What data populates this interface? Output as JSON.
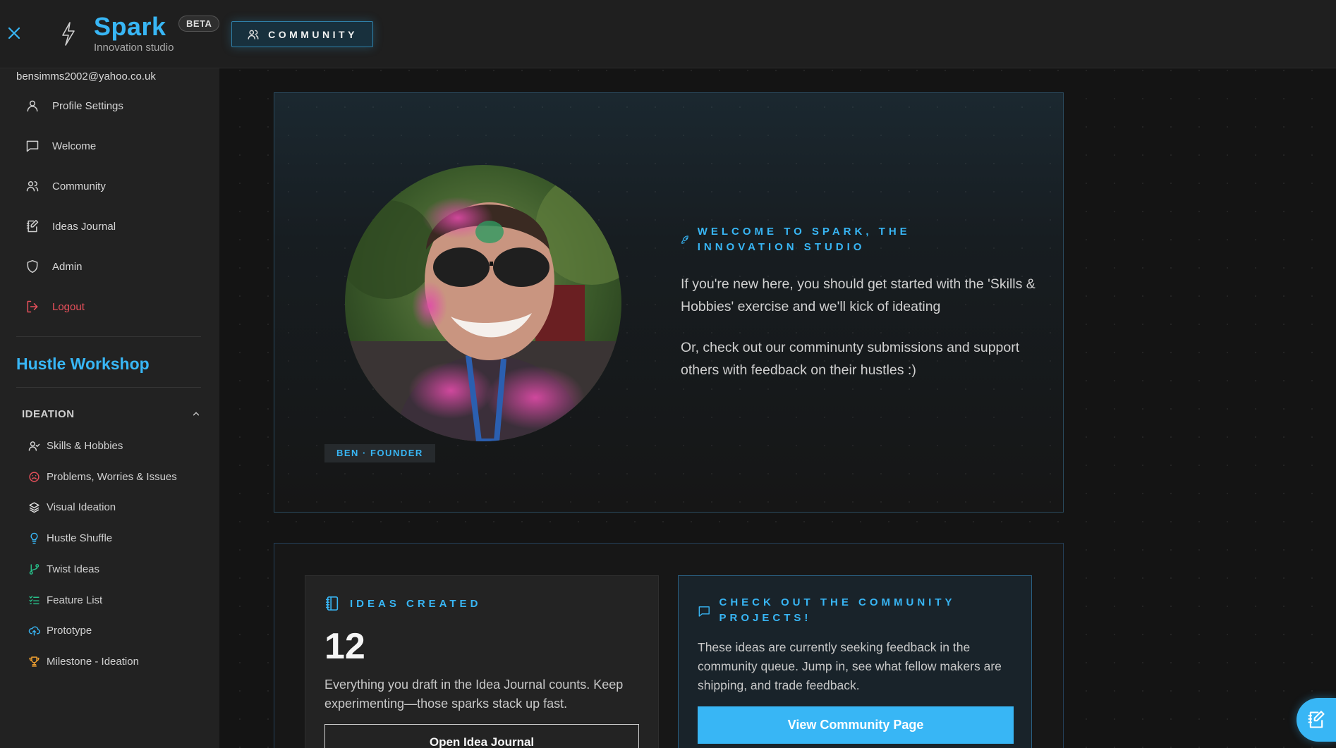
{
  "header": {
    "brand": "Spark",
    "subtitle": "Innovation studio",
    "badge": "BETA",
    "community_button": "COMMUNITY"
  },
  "sidebar": {
    "email": "bensimms2002@yahoo.co.uk",
    "items": [
      {
        "label": "Profile Settings",
        "icon": "user-icon"
      },
      {
        "label": "Welcome",
        "icon": "chat-icon"
      },
      {
        "label": "Community",
        "icon": "users-icon"
      },
      {
        "label": "Ideas Journal",
        "icon": "journal-edit-icon"
      },
      {
        "label": "Admin",
        "icon": "shield-icon"
      },
      {
        "label": "Logout",
        "icon": "logout-icon"
      }
    ],
    "workshop_title": "Hustle Workshop",
    "section": {
      "title": "IDEATION",
      "items": [
        {
          "label": "Skills & Hobbies",
          "icon": "user-check-icon"
        },
        {
          "label": "Problems, Worries & Issues",
          "icon": "frown-icon"
        },
        {
          "label": "Visual Ideation",
          "icon": "layers-icon"
        },
        {
          "label": "Hustle Shuffle",
          "icon": "lightbulb-icon"
        },
        {
          "label": "Twist Ideas",
          "icon": "git-branch-icon"
        },
        {
          "label": "Feature List",
          "icon": "list-checks-icon"
        },
        {
          "label": "Prototype",
          "icon": "cloud-upload-icon"
        },
        {
          "label": "Milestone - Ideation",
          "icon": "trophy-icon"
        }
      ]
    }
  },
  "hero": {
    "founder_badge": "BEN · FOUNDER",
    "heading": "Welcome to Spark, the Innovation Studio",
    "paragraph1": "If you're new here, you should get started with the 'Skills & Hobbies' exercise and we'll kick of ideating",
    "paragraph2": "Or, check out our comminunty submissions and support others with feedback on their hustles :)"
  },
  "ideas_card": {
    "heading": "IDEAS CREATED",
    "count": "12",
    "description": "Everything you draft in the Idea Journal counts. Keep experimenting—those sparks stack up fast.",
    "button": "Open Idea Journal"
  },
  "community_card": {
    "heading": "Check out the community projects!",
    "description": "These ideas are currently seeking feedback in the community queue. Jump in, see what fellow makers are shipping, and trade feedback.",
    "button": "View Community Page"
  },
  "colors": {
    "accent": "#38b6f5",
    "danger": "#e8505b",
    "background": "#141414",
    "sidebar": "#222222"
  }
}
